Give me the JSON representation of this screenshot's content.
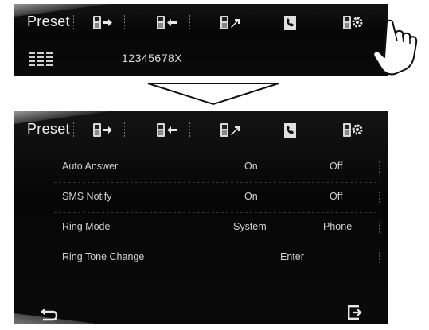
{
  "top_panel": {
    "title": "Preset",
    "phone_number": "12345678X",
    "toolbar_icons": [
      "phone-send-icon",
      "phone-receive-icon",
      "phone-transfer-icon",
      "phonebook-icon",
      "phone-settings-icon"
    ]
  },
  "bottom_panel": {
    "title": "Preset",
    "settings": [
      {
        "label": "Auto Answer",
        "options": [
          "On",
          "Off"
        ]
      },
      {
        "label": "SMS Notify",
        "options": [
          "On",
          "Off"
        ]
      },
      {
        "label": "Ring Mode",
        "options": [
          "System",
          "Phone"
        ]
      },
      {
        "label": "Ring Tone Change",
        "options": [
          "Enter"
        ]
      }
    ],
    "footer_icons": [
      "back-icon",
      "exit-icon"
    ]
  },
  "colors": {
    "screen_background": "#050505",
    "text": "#e6e6e6",
    "page_background": "#ffffff"
  }
}
